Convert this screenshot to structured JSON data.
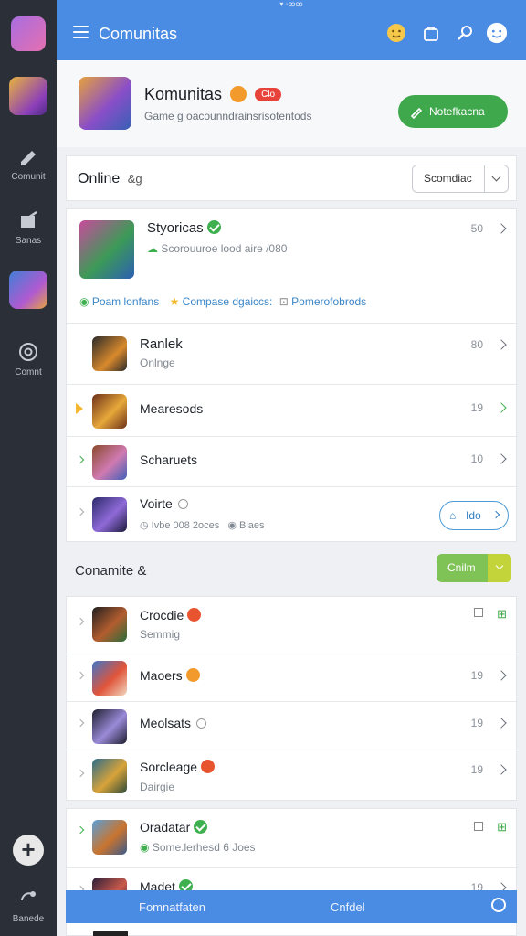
{
  "status_bar": {
    "text": "▾ ◦ꝏꝏ"
  },
  "header": {
    "title": "Comunitas"
  },
  "rail": {
    "items": [
      {
        "label": "Comunit"
      },
      {
        "label": "Sanas"
      },
      {
        "label": "Comnt"
      }
    ],
    "bottom_label": "Banede"
  },
  "profile": {
    "name": "Komunitas",
    "badge": "C̶lo",
    "subtitle": "Game g oacounndrainsrisotentods",
    "action_label": "Notefkacna"
  },
  "filter": {
    "title": "Online",
    "suffix": "&g",
    "dropdown_label": "Scomdiac"
  },
  "featured": {
    "title": "Styoricas",
    "subtitle": "Scorouuroe lood aire /080",
    "count": "50",
    "links": [
      "Poam lonfans",
      "Compase dgaiccs:",
      "Pomerofobrods"
    ]
  },
  "list1": [
    {
      "title": "Ranlek",
      "sub": "Onlnge",
      "count": "80"
    },
    {
      "title": "Mearesods",
      "sub": "",
      "count": "19"
    },
    {
      "title": "Scharuets",
      "sub": "",
      "count": "10"
    },
    {
      "title": "Voirte",
      "sub": "Ivbe 008 2oces",
      "sub2": "Blaes",
      "button": "Ido"
    }
  ],
  "section2": {
    "title": "Conamite &",
    "button": "Cnilm"
  },
  "list2": [
    {
      "title": "Crocdie",
      "sub": "Semmig",
      "count": ""
    },
    {
      "title": "Maoers",
      "sub": "",
      "count": "19"
    },
    {
      "title": "Meolsats",
      "sub": "",
      "count": "19"
    },
    {
      "title": "Sorcleage",
      "sub": "Dairgie",
      "count": "19"
    }
  ],
  "list3": [
    {
      "title": "Oradatar",
      "sub": "Some.lerhesd 6 Joes"
    },
    {
      "title": "Madet",
      "sub": "",
      "count": "19"
    }
  ],
  "footer_bar": {
    "left": "Fomnatfaten",
    "center": "Cnfdel"
  },
  "colors": {
    "primary": "#4a8be3",
    "green": "#3fb04f",
    "rail": "#2b3038"
  }
}
